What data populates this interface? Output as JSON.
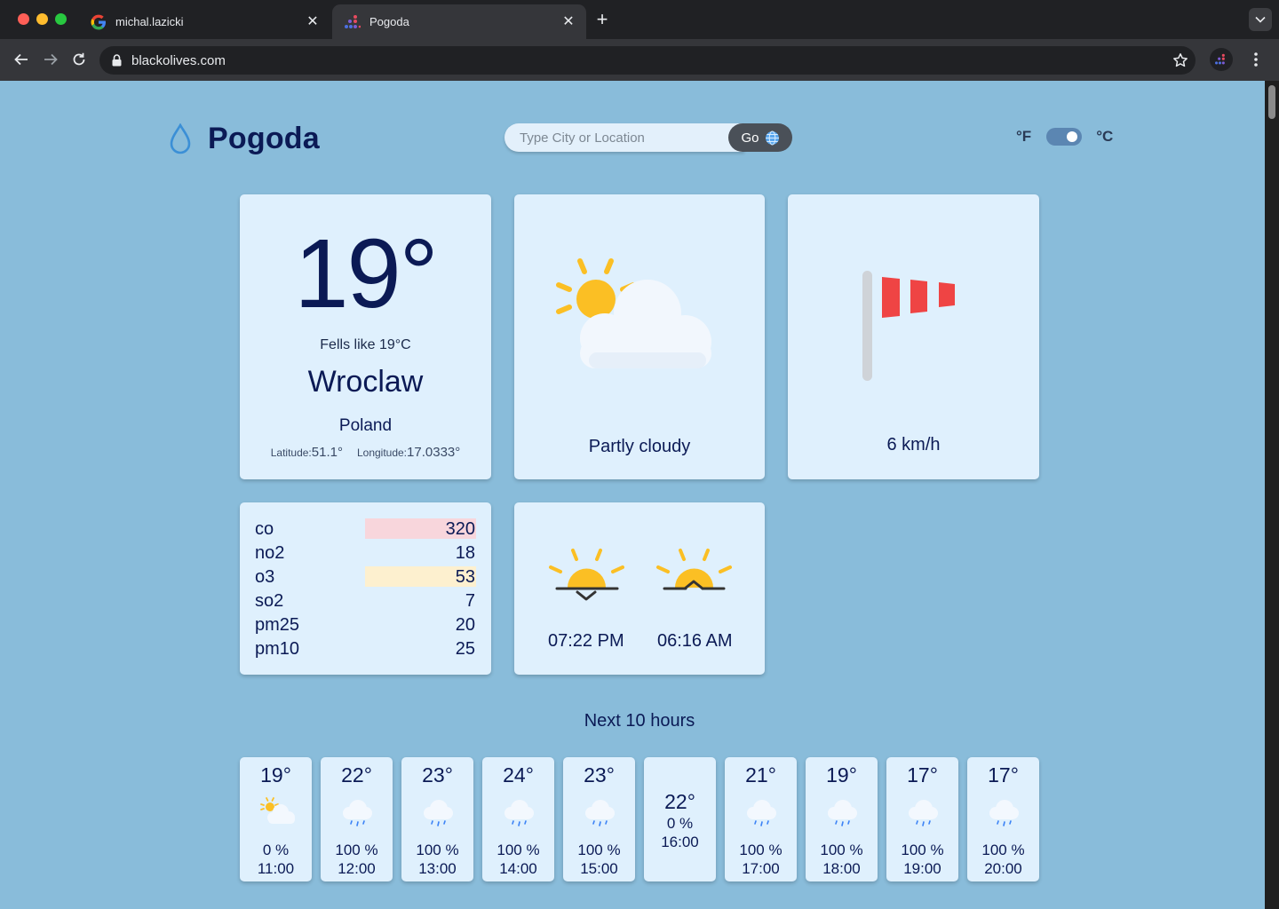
{
  "browser": {
    "tabs": [
      {
        "title": "michal.lazicki",
        "favicon": "google-icon"
      },
      {
        "title": "Pogoda",
        "favicon": "pogoda-icon"
      }
    ],
    "url": "blackolives.com"
  },
  "app": {
    "name": "Pogoda",
    "search_placeholder": "Type City or Location",
    "go_label": "Go",
    "unit_f": "°F",
    "unit_c": "°C",
    "unit_selected": "C"
  },
  "current": {
    "temp": "19°",
    "feels_like": "Fells like 19°C",
    "city": "Wroclaw",
    "country": "Poland",
    "lat_label": "Latitude:",
    "lat_value": "51.1°",
    "lon_label": "Longitude:",
    "lon_value": "17.0333°",
    "condition": "Partly cloudy",
    "wind": "6 km/h"
  },
  "air_quality": [
    {
      "name": "co",
      "value": "320",
      "highlight": "#f8d6dc"
    },
    {
      "name": "no2",
      "value": "18",
      "highlight": ""
    },
    {
      "name": "o3",
      "value": "53",
      "highlight": "#fdf0cf"
    },
    {
      "name": "so2",
      "value": "7",
      "highlight": ""
    },
    {
      "name": "pm25",
      "value": "20",
      "highlight": ""
    },
    {
      "name": "pm10",
      "value": "25",
      "highlight": ""
    }
  ],
  "sun": {
    "sunset": "07:22 PM",
    "sunrise": "06:16 AM"
  },
  "forecast_title": "Next 10 hours",
  "hourly": [
    {
      "temp": "19°",
      "chance": "0 %",
      "hour": "11:00",
      "icon": "partly-cloudy-icon"
    },
    {
      "temp": "22°",
      "chance": "100 %",
      "hour": "12:00",
      "icon": "rain-cloud-icon"
    },
    {
      "temp": "23°",
      "chance": "100 %",
      "hour": "13:00",
      "icon": "rain-cloud-icon"
    },
    {
      "temp": "24°",
      "chance": "100 %",
      "hour": "14:00",
      "icon": "rain-cloud-icon"
    },
    {
      "temp": "23°",
      "chance": "100 %",
      "hour": "15:00",
      "icon": "rain-cloud-icon"
    },
    {
      "temp": "22°",
      "chance": "0 %",
      "hour": "16:00",
      "icon": ""
    },
    {
      "temp": "21°",
      "chance": "100 %",
      "hour": "17:00",
      "icon": "rain-cloud-icon"
    },
    {
      "temp": "19°",
      "chance": "100 %",
      "hour": "18:00",
      "icon": "rain-cloud-icon"
    },
    {
      "temp": "17°",
      "chance": "100 %",
      "hour": "19:00",
      "icon": "rain-cloud-icon"
    },
    {
      "temp": "17°",
      "chance": "100 %",
      "hour": "20:00",
      "icon": "rain-cloud-icon"
    }
  ],
  "colors": {
    "page_bg": "#89bcda",
    "card_bg": "#dff0fd",
    "text_dark": "#0b1a55",
    "sun": "#fbbf24",
    "windsock": "#ef4444"
  }
}
